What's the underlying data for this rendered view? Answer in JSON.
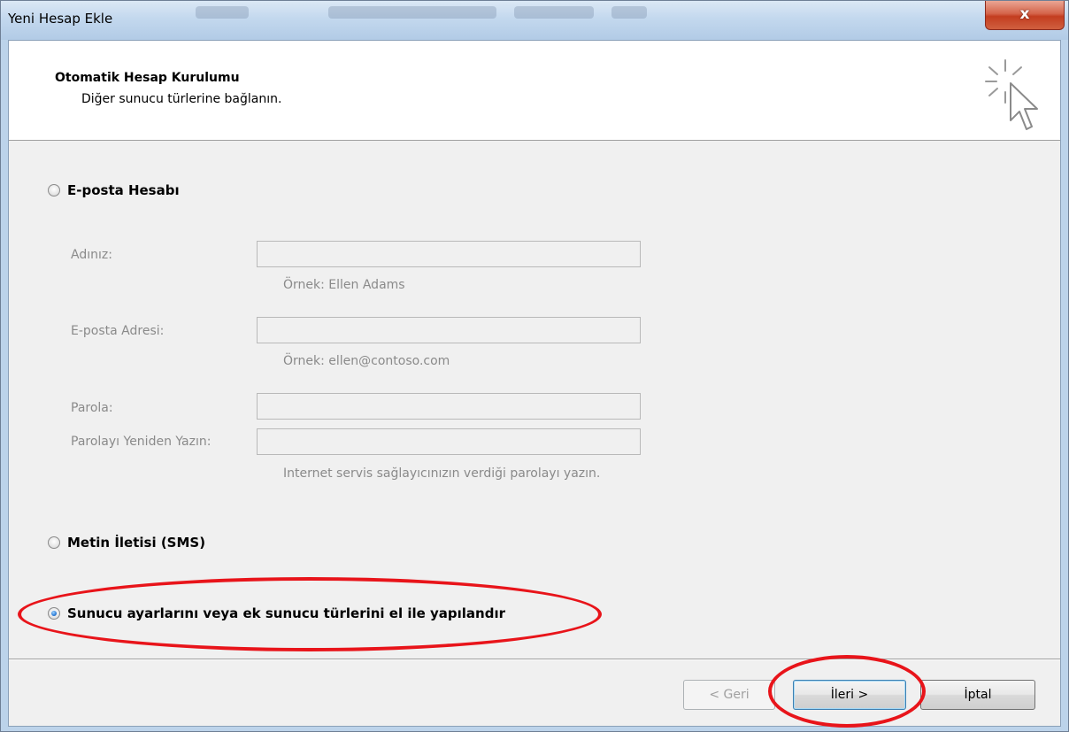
{
  "window": {
    "title": "Yeni Hesap Ekle",
    "close_label": "x"
  },
  "header": {
    "title": "Otomatik Hesap Kurulumu",
    "subtitle": "Diğer sunucu türlerine bağlanın."
  },
  "options": {
    "email_account": "E-posta Hesabı",
    "sms": "Metin İletisi (SMS)",
    "manual": "Sunucu ayarlarını veya ek sunucu türlerini el ile yapılandır",
    "selected": "manual"
  },
  "form": {
    "name_label": "Adınız:",
    "name_value": "",
    "name_hint": "Örnek: Ellen Adams",
    "email_label": "E-posta Adresi:",
    "email_value": "",
    "email_hint": "Örnek: ellen@contoso.com",
    "password_label": "Parola:",
    "password_value": "",
    "password_retype_label": "Parolayı Yeniden Yazın:",
    "password_retype_value": "",
    "password_hint": "Internet servis sağlayıcınızın verdiği parolayı yazın."
  },
  "buttons": {
    "back": "< Geri",
    "next": "İleri >",
    "cancel": "İptal"
  },
  "colors": {
    "annotation": "#e8141a",
    "disabled_text": "#8a8a8a"
  }
}
